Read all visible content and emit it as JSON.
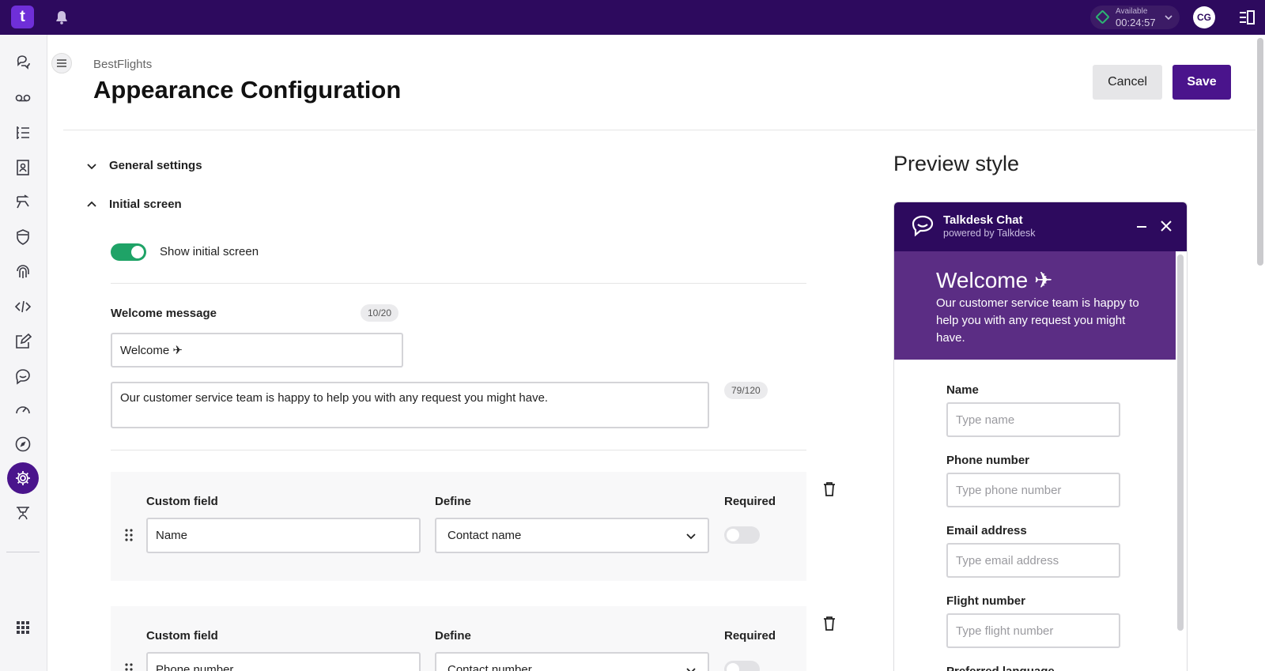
{
  "topbar": {
    "logo_text": "t",
    "status": {
      "label": "Available",
      "time": "00:24:57",
      "color": "#2bb673"
    },
    "avatar_initials": "CG"
  },
  "nav": {
    "icons": [
      "conversations-icon",
      "voicemail-icon",
      "list-icon",
      "contacts-icon",
      "routing-icon",
      "shield-icon",
      "fingerprint-icon",
      "code-icon",
      "edit-icon",
      "chat-icon",
      "speedometer-icon",
      "compass-icon",
      "settings-icon",
      "agent-icon",
      "apps-grid-icon"
    ],
    "active": "settings-icon"
  },
  "header": {
    "breadcrumb": "BestFlights",
    "title": "Appearance Configuration",
    "cancel_label": "Cancel",
    "save_label": "Save"
  },
  "sections": {
    "general": "General settings",
    "initial": "Initial screen"
  },
  "initial_screen": {
    "toggle_label": "Show initial screen",
    "toggle_on": true,
    "welcome_label": "Welcome message",
    "welcome_counter": "10/20",
    "welcome_value": "Welcome ✈",
    "description_value": "Our customer service team is happy to help you with any request you might have.",
    "description_counter": "79/120"
  },
  "custom_fields": [
    {
      "field_header": "Custom field",
      "define_header": "Define",
      "required_header": "Required",
      "field_value": "Name",
      "define_value": "Contact name",
      "required": false
    },
    {
      "field_header": "Custom field",
      "define_header": "Define",
      "required_header": "Required",
      "field_value": "Phone number",
      "define_value": "Contact number",
      "required": false
    }
  ],
  "preview": {
    "title": "Preview style",
    "chat_title": "Talkdesk Chat",
    "chat_subtitle": "powered by Talkdesk",
    "welcome_title": "Welcome ✈",
    "welcome_text": "Our customer service team is happy to help you with any request you might have.",
    "fields": [
      {
        "label": "Name",
        "placeholder": "Type name"
      },
      {
        "label": "Phone number",
        "placeholder": "Type phone number"
      },
      {
        "label": "Email address",
        "placeholder": "Type email address"
      },
      {
        "label": "Flight number",
        "placeholder": "Type flight number"
      },
      {
        "label": "Preferred language",
        "placeholder": ""
      }
    ]
  },
  "colors": {
    "brand": "#2d0a5e",
    "accent": "#4a148c",
    "welcome_bg": "#5b2d84",
    "toggle_on": "#1fa367"
  }
}
